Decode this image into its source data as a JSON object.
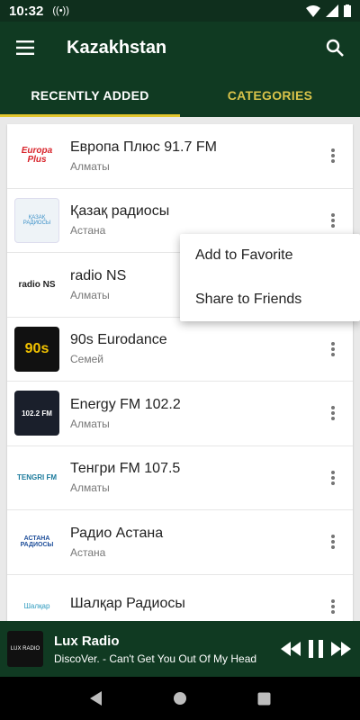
{
  "status_bar": {
    "time": "10:32"
  },
  "app_bar": {
    "title": "Kazakhstan"
  },
  "tabs": [
    {
      "label": "RECENTLY ADDED",
      "active": true
    },
    {
      "label": "CATEGORIES",
      "active": false
    }
  ],
  "stations": [
    {
      "name": "Европа Плюс 91.7 FM",
      "city": "Алматы",
      "logo_text": "Europa Plus"
    },
    {
      "name": "Қазақ радиосы",
      "city": "Астана",
      "logo_text": "ҚАЗАҚ РАДИОСЫ"
    },
    {
      "name": "radio NS",
      "city": "Алматы",
      "logo_text": "radio NS"
    },
    {
      "name": "90s Eurodance",
      "city": "Семей",
      "logo_text": "90s"
    },
    {
      "name": "Energy FM 102.2",
      "city": "Алматы",
      "logo_text": "102.2 FM"
    },
    {
      "name": "Тенгри FM 107.5",
      "city": "Алматы",
      "logo_text": "TENGRI FM"
    },
    {
      "name": "Радио Астана",
      "city": "Астана",
      "logo_text": "АСТАНА РАДИОСЫ"
    },
    {
      "name": "Шалқар Радиосы",
      "city": "",
      "logo_text": "Шалқар"
    }
  ],
  "popup_menu": {
    "items": [
      "Add to Favorite",
      "Share to Friends"
    ]
  },
  "player": {
    "title": "Lux Radio",
    "subtitle": "DiscoVer. - Can't Get You Out Of My Head",
    "cover_text": "LUX RADIO"
  },
  "colors": {
    "primary": "#103a22",
    "accent": "#e2c62d",
    "status_bar": "#0f2f1d"
  }
}
